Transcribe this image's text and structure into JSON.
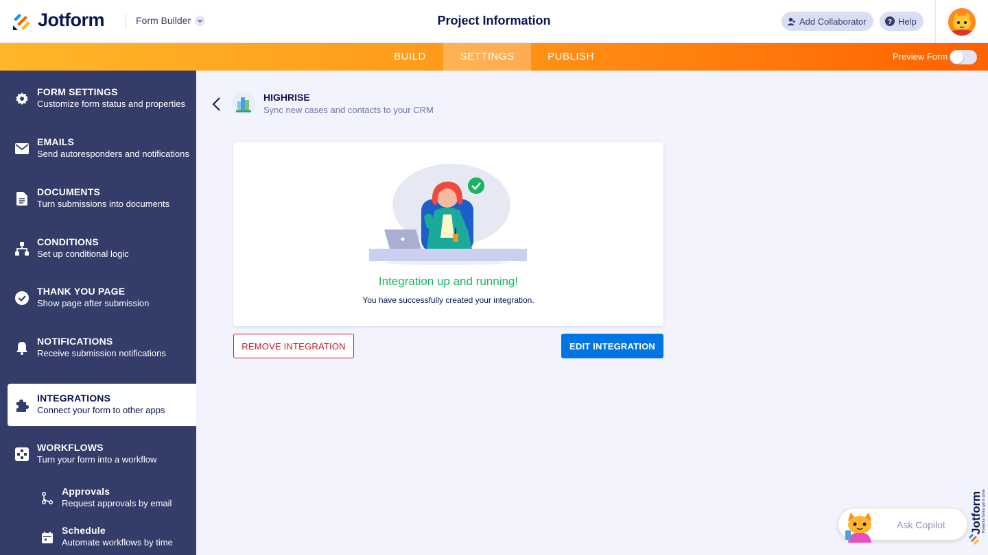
{
  "header": {
    "brand": "Jotform",
    "builder_label": "Form Builder",
    "page_title": "Project Information",
    "add_collaborator": "Add Collaborator",
    "help": "Help"
  },
  "nav": {
    "tabs": [
      {
        "label": "BUILD"
      },
      {
        "label": "SETTINGS"
      },
      {
        "label": "PUBLISH"
      }
    ],
    "preview_label": "Preview Form",
    "preview_on": false
  },
  "sidebar": {
    "items": [
      {
        "title": "FORM SETTINGS",
        "subtitle": "Customize form status and properties",
        "icon": "gear-icon"
      },
      {
        "title": "EMAILS",
        "subtitle": "Send autoresponders and notifications",
        "icon": "envelope-icon"
      },
      {
        "title": "DOCUMENTS",
        "subtitle": "Turn submissions into documents",
        "icon": "document-icon"
      },
      {
        "title": "CONDITIONS",
        "subtitle": "Set up conditional logic",
        "icon": "hierarchy-icon"
      },
      {
        "title": "THANK YOU PAGE",
        "subtitle": "Show page after submission",
        "icon": "check-circle-icon"
      },
      {
        "title": "NOTIFICATIONS",
        "subtitle": "Receive submission notifications",
        "icon": "bell-icon"
      },
      {
        "title": "INTEGRATIONS",
        "subtitle": "Connect your form to other apps",
        "icon": "puzzle-icon"
      },
      {
        "title": "WORKFLOWS",
        "subtitle": "Turn your form into a workflow",
        "icon": "workflow-icon"
      },
      {
        "title": "Approvals",
        "subtitle": "Request approvals by email",
        "icon": "approval-flow-icon"
      },
      {
        "title": "Schedule",
        "subtitle": "Automate workflows by time",
        "icon": "calendar-icon"
      }
    ],
    "active_index": 6
  },
  "integration": {
    "name": "HIGHRISE",
    "description": "Sync new cases and contacts to your CRM",
    "status_title": "Integration up and running!",
    "status_desc": "You have successfully created your integration.",
    "remove_label": "REMOVE INTEGRATION",
    "edit_label": "EDIT INTEGRATION"
  },
  "copilot": {
    "label": "Ask Copilot"
  },
  "side_brand": {
    "name": "Jotform",
    "tagline": "Powerful forms get it done"
  },
  "colors": {
    "accent_orange": "#ff6100",
    "sidebar_bg": "#343c6a",
    "primary_blue": "#0075e3",
    "danger_red": "#c9171f",
    "success_green": "#18b55e"
  }
}
